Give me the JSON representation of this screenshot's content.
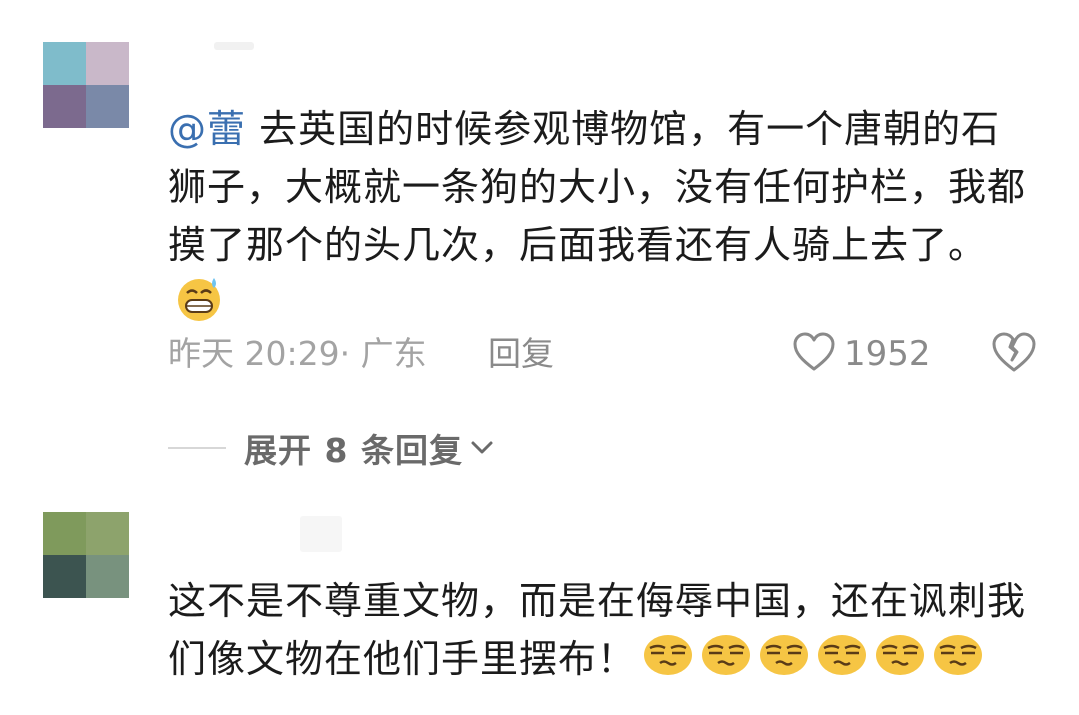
{
  "comments": [
    {
      "mention": "@蕾",
      "text": " 去英国的时候参观博物馆，有一个唐朝的石狮子，大概就一条狗的大小，没有任何护栏，我都摸了那个的头几次，后面我看还有人骑上去了。",
      "emoji_icons": [
        "grin-sweat-emoji-icon"
      ],
      "time": "昨天 20:29",
      "location": "· 广东",
      "reply_label": "回复",
      "like_count": "1952",
      "expand_label": "展开 8 条回复"
    },
    {
      "text": "这不是不尊重文物，而是在侮辱中国，还在讽刺我们像文物在他们手里摆布！",
      "emoji_icons": [
        "unamused-emoji-icon",
        "unamused-emoji-icon",
        "unamused-emoji-icon",
        "unamused-emoji-icon",
        "unamused-emoji-icon",
        "unamused-emoji-icon"
      ]
    }
  ],
  "colors": {
    "mention": "#3a6fb0",
    "meta_text": "#a3a3a3",
    "body_text": "#1b1b1b",
    "emoji_yellow": "#f6c544"
  }
}
